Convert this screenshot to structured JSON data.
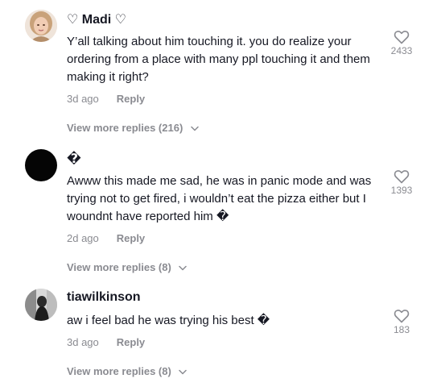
{
  "comments": [
    {
      "username": "♡ Madi ♡",
      "text": "Y’all talking about him touching it. you do realize your ordering from a place with many ppl touching it and them making it right?",
      "time": "3d ago",
      "reply_label": "Reply",
      "likes": "2433",
      "view_more": "View more replies (216)",
      "avatar_style": "blonde-photo"
    },
    {
      "username": "�",
      "text": "Awww this made me sad, he was in panic mode and was trying not to get fired, i wouldn’t eat the pizza either but I woundnt have reported him �",
      "time": "2d ago",
      "reply_label": "Reply",
      "likes": "1393",
      "view_more": "View more replies (8)",
      "avatar_style": "black-circle"
    },
    {
      "username": "tiawilkinson",
      "text": "aw i feel bad he was trying his best �",
      "time": "3d ago",
      "reply_label": "Reply",
      "likes": "183",
      "view_more": "View more replies (8)",
      "avatar_style": "grayscale-photo"
    }
  ],
  "colors": {
    "text_primary": "#161823",
    "text_secondary": "#8a8b91",
    "icon_stroke": "#8a8b91"
  },
  "icons": {
    "like": "heart-outline-icon",
    "expand": "chevron-down-icon"
  }
}
